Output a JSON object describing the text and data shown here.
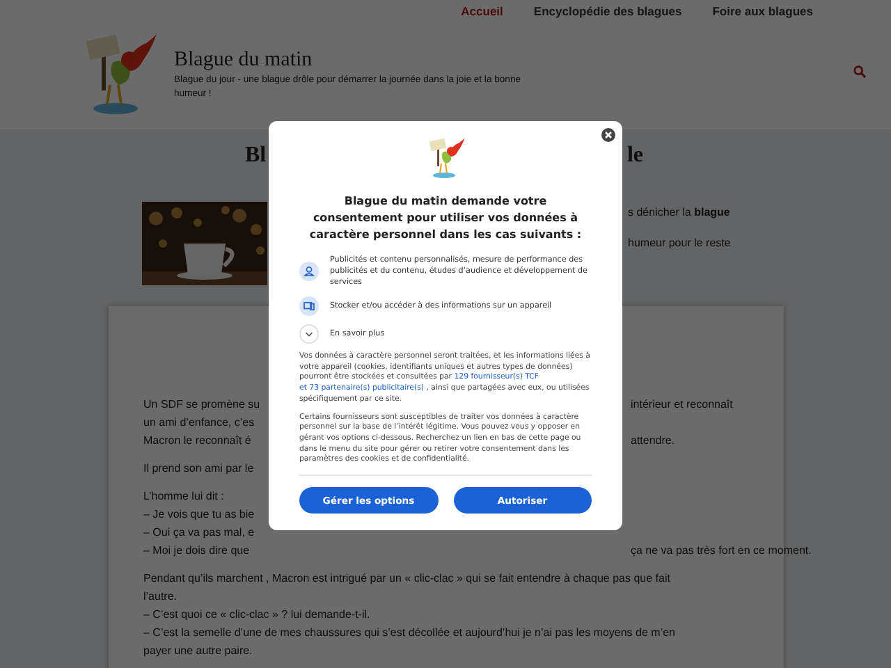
{
  "nav": [
    {
      "label": "Accueil",
      "selected": true
    },
    {
      "label": "Encyclopédie des blagues",
      "selected": false
    },
    {
      "label": "Foire aux blagues",
      "selected": false
    }
  ],
  "site": {
    "title": "Blague du matin",
    "tagline": "Blague du jour - une blague drôle pour démarrer la journée dans la joie et la bonne humeur !"
  },
  "article": {
    "heading_left": "Bl",
    "heading_right": "le",
    "intro": [
      "s dénicher la **blague**",
      "humeur pour le reste"
    ],
    "paragraphs": [
      [
        {
          "left": "Un SDF se promène su",
          "right": "intérieur et reconnaît"
        },
        {
          "left": "un ami d’enfance, c’es"
        },
        {
          "left": "Macron le reconnaît é",
          "right": "attendre."
        }
      ],
      [
        {
          "left": "Il prend son ami par le"
        }
      ],
      [
        {
          "left": "L’homme lui dit :"
        },
        {
          "left": "– Je vois que tu as bie"
        },
        {
          "left": "– Oui ça va pas mal, e"
        },
        {
          "left": "– Moi je dois dire que",
          "right": "ça ne va pas très fort en ce moment."
        }
      ],
      [
        {
          "text": "Pendant qu’ils marchent , Macron est intrigué par un « clic-clac » qui se fait entendre à chaque pas que fait"
        },
        {
          "text": "l’autre."
        },
        {
          "text": "– C’est quoi ce « clic-clac » ? lui demande-t-il."
        },
        {
          "text": "– C’est la semelle d’une de mes chaussures qui s’est décollée et aujourd’hui je n’ai pas les moyens de m’en"
        },
        {
          "text": "payer une autre paire."
        }
      ]
    ]
  },
  "consent": {
    "title": "Blague du matin demande votre consentement pour utiliser vos données à caractère personnel dans les cas suivants :",
    "purposes": [
      {
        "kind": "person",
        "text": "Publicités et contenu personnalisés, mesure de performance des publicités et du contenu, études d’audience et développement de services"
      },
      {
        "kind": "device",
        "text": "Stocker et/ou accéder à des informations sur un appareil"
      }
    ],
    "more": "En savoir plus",
    "notice": {
      "before": "Vos données à caractère personnel seront traitées, et les informations liées à votre appareil (cookies, identifiants uniques et autres types de données) pourront être stockées et consultées par",
      "links": [
        "129 fournisseur(s) TCF",
        "et 73 partenaire(s) publicitaire(s)"
      ],
      "after": ", ainsi que partagées avec eux, ou utilisées spécifiquement par ce site."
    },
    "notice2": "Certains fournisseurs sont susceptibles de traiter vos données à caractère personnel sur la base de l’intérêt légitime. Vous pouvez vous y opposer en gérant vos options ci-dessous. Recherchez un lien en bas de cette page ou dans le menu du site pour gérer ou retirer votre consentement dans les paramètres des cookies et de confidentialité.",
    "buttons": [
      "Gérer les options",
      "Autoriser"
    ]
  }
}
